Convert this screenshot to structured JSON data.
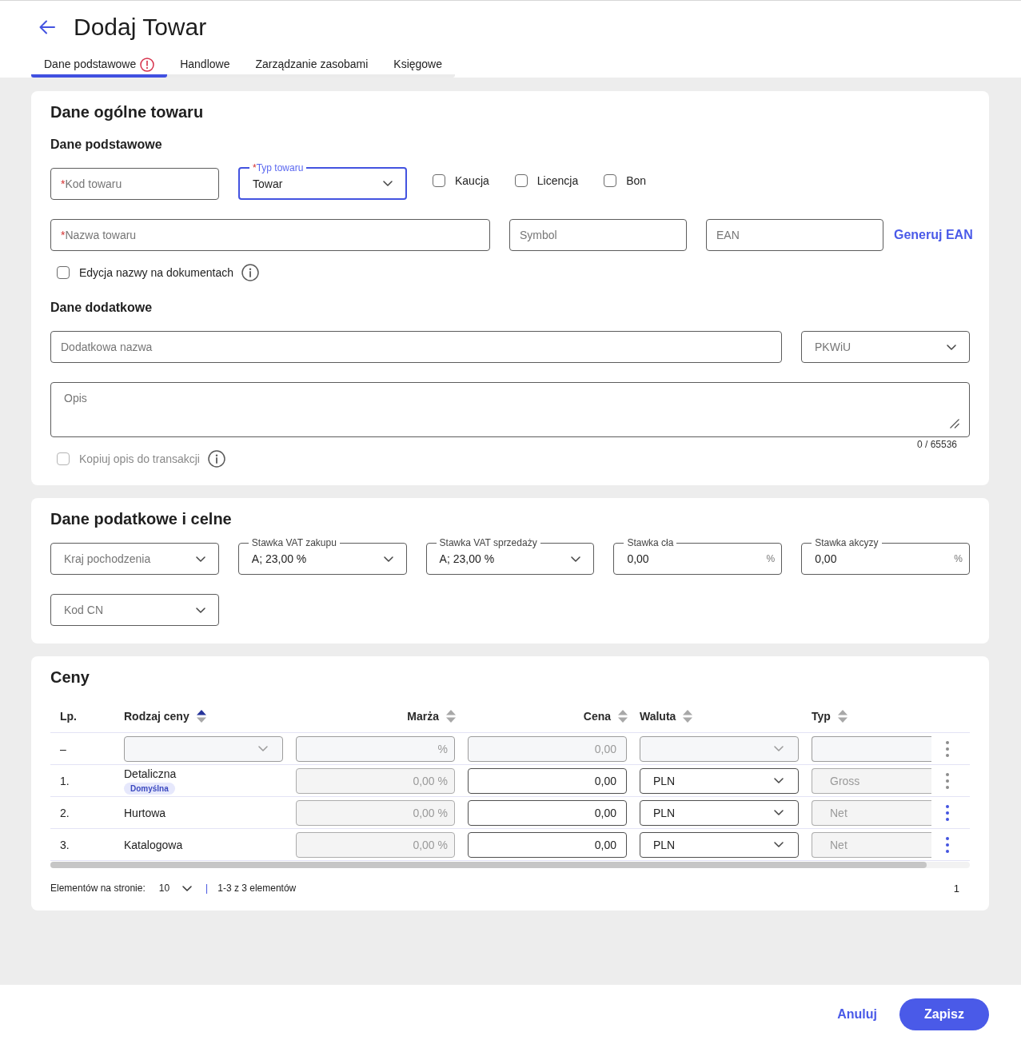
{
  "header": {
    "title": "Dodaj Towar",
    "tabs": [
      {
        "label": "Dane podstawowe",
        "selected": true,
        "error": true
      },
      {
        "label": "Handlowe",
        "selected": false,
        "error": false
      },
      {
        "label": "Zarządzanie zasobami",
        "selected": false,
        "error": false
      },
      {
        "label": "Księgowe",
        "selected": false,
        "error": false
      }
    ]
  },
  "general": {
    "title": "Dane ogólne towaru",
    "basic_heading": "Dane podstawowe",
    "row_1_fields": [
      {
        "kind": "input",
        "required_mark": "*",
        "placeholder": "Kod towaru",
        "focused": false
      },
      {
        "kind": "select",
        "required_mark": "*",
        "label": "Typ towaru",
        "value": "Towar",
        "focused": true
      }
    ],
    "flags": [
      {
        "label": "Kaucja",
        "checked": false,
        "disabled": false
      },
      {
        "label": "Licencja",
        "checked": false,
        "disabled": false
      },
      {
        "label": "Bon",
        "checked": false,
        "disabled": false
      }
    ],
    "row_2_fields": [
      {
        "kind": "input",
        "required_mark": "*",
        "placeholder": "Nazwa towaru",
        "focused": false
      },
      {
        "kind": "input",
        "placeholder": "Symbol",
        "focused": false
      },
      {
        "kind": "input",
        "placeholder": "EAN",
        "focused": false
      }
    ],
    "generate_ean_link": "Generuj EAN",
    "name_edit_option": {
      "label": "Edycja nazwy na dokumentach",
      "checked": false,
      "disabled": false,
      "info": true
    },
    "extra_heading": "Dane dodatkowe",
    "row_3_fields": [
      {
        "kind": "input",
        "placeholder": "Dodatkowa nazwa",
        "focused": false
      },
      {
        "kind": "select",
        "placeholder": "PKWiU",
        "focused": false
      }
    ],
    "description": {
      "placeholder": "Opis",
      "counter": "0 / 65536"
    },
    "copy_description_option": {
      "label": "Kopiuj opis do transakcji",
      "checked": false,
      "disabled": true,
      "info": true
    }
  },
  "tax": {
    "title": "Dane podatkowe i celne",
    "fields": [
      {
        "kind": "select",
        "placeholder": "Kraj pochodzenia",
        "focused": false
      },
      {
        "kind": "select",
        "label": "Stawka VAT zakupu",
        "value": "A; 23,00 %",
        "focused": false
      },
      {
        "kind": "select",
        "label": "Stawka VAT sprzedaży",
        "value": "A; 23,00 %",
        "focused": false
      },
      {
        "kind": "input",
        "label": "Stawka cła",
        "value": "0,00",
        "suffix": "%",
        "focused": false
      },
      {
        "kind": "input",
        "label": "Stawka akcyzy",
        "value": "0,00",
        "suffix": "%",
        "focused": false
      },
      {
        "kind": "select",
        "placeholder": "Kod CN",
        "focused": false
      }
    ]
  },
  "prices": {
    "title": "Ceny",
    "columns": [
      {
        "label": "Lp.",
        "sortable": false
      },
      {
        "label": "Rodzaj ceny",
        "sortable": true,
        "sorted_ascending": true
      },
      {
        "label": "Marża",
        "sortable": true,
        "sorted_ascending": false
      },
      {
        "label": "Cena",
        "sortable": true,
        "sorted_ascending": false
      },
      {
        "label": "Waluta",
        "sortable": true,
        "sorted_ascending": false
      },
      {
        "label": "Typ",
        "sortable": true,
        "sorted_ascending": false
      }
    ],
    "filter_row": {
      "lp": "–",
      "margin_suffix": "%",
      "price_placeholder": "0,00",
      "menu_disabled": true
    },
    "rows": [
      {
        "lp": "1.",
        "name": "Detaliczna",
        "badge": "Domyślna",
        "margin": {
          "value": "0,00 %",
          "disabled": true
        },
        "price": {
          "value": "0,00",
          "disabled": false
        },
        "currency": {
          "value": "PLN",
          "disabled": false
        },
        "type": {
          "value": "Gross",
          "disabled": true
        },
        "menu_disabled": true
      },
      {
        "lp": "2.",
        "name": "Hurtowa",
        "margin": {
          "value": "0,00 %",
          "disabled": true
        },
        "price": {
          "value": "0,00",
          "disabled": false
        },
        "currency": {
          "value": "PLN",
          "disabled": false
        },
        "type": {
          "value": "Net",
          "disabled": true
        },
        "menu_disabled": false
      },
      {
        "lp": "3.",
        "name": "Katalogowa",
        "margin": {
          "value": "0,00 %",
          "disabled": true
        },
        "price": {
          "value": "0,00",
          "disabled": false
        },
        "currency": {
          "value": "PLN",
          "disabled": false
        },
        "type": {
          "value": "Net",
          "disabled": true
        },
        "menu_disabled": false
      }
    ],
    "pagination": {
      "page_size_label": "Elementów na stronie:",
      "page_size": "10",
      "separator": "|",
      "range": "1-3 z 3 elementów",
      "current_page": "1"
    }
  },
  "footer": {
    "cancel": "Anuluj",
    "save": "Zapisz"
  }
}
